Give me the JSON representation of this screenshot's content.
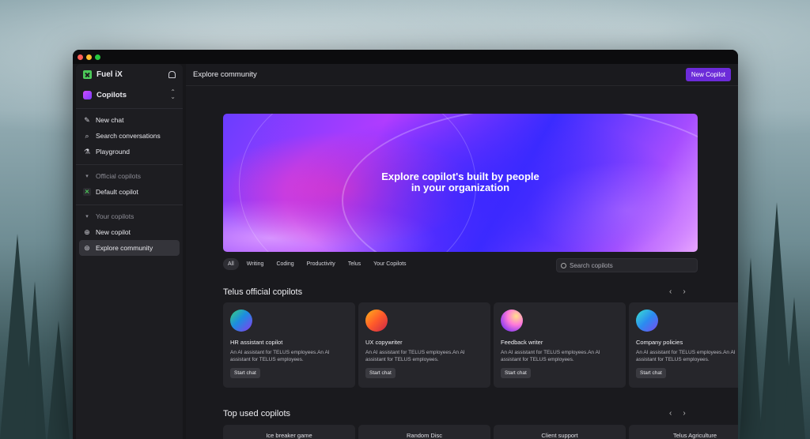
{
  "sidebar": {
    "brand": "Fuel iX",
    "selector": "Copilots",
    "nav": [
      "New chat",
      "Search conversations",
      "Playground"
    ],
    "official_group": "Official copilots",
    "official_items": [
      "Default copilot"
    ],
    "your_group": "Your copilots",
    "your_items": [
      "New copilot",
      "Explore community"
    ]
  },
  "header": {
    "title": "Explore community",
    "new_copilot_label": "New Copilot"
  },
  "hero": {
    "line1": "Explore copilot's built by people",
    "line2": "in your organization"
  },
  "filters": [
    "All",
    "Writing",
    "Coding",
    "Productivity",
    "Telus",
    "Your Copilots"
  ],
  "search": {
    "placeholder": "Search copilots"
  },
  "sections": {
    "official_title": "Telus official copilots",
    "top_title": "Top used copilots"
  },
  "official_cards": [
    {
      "title": "HR assistant copilot",
      "desc": "An AI assistant for TELUS employees.An AI assistant for TELUS employees.",
      "button": "Start chat"
    },
    {
      "title": "UX copywriter",
      "desc": "An AI assistant for TELUS employees.An AI assistant for TELUS employees.",
      "button": "Start chat"
    },
    {
      "title": "Feedback writer",
      "desc": "An AI assistant for TELUS employees.An AI assistant for TELUS employees.",
      "button": "Start chat"
    },
    {
      "title": "Company policies",
      "desc": "An AI assistant for TELUS employees.An AI assistant for TELUS employees.",
      "button": "Start chat"
    }
  ],
  "top_cards": [
    "Ice breaker game",
    "Random Disc",
    "Client support",
    "Telus Agriculture"
  ],
  "colors": {
    "accent": "#6c2bd9",
    "brand_green": "#4cc959"
  }
}
